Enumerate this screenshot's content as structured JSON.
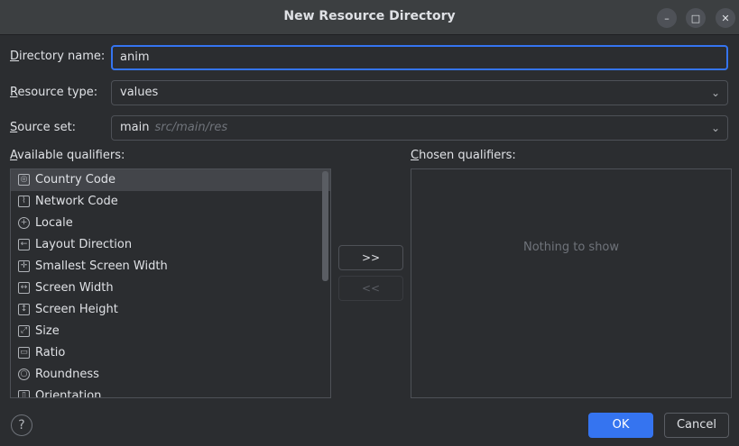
{
  "window": {
    "title": "New Resource Directory",
    "minimize": "–",
    "maximize": "□",
    "close": "✕"
  },
  "form": {
    "directory_name_label_first": "D",
    "directory_name_label_rest": "irectory name:",
    "directory_name_value": "anim",
    "resource_type_label_first": "R",
    "resource_type_label_rest": "esource type:",
    "resource_type_value": "values",
    "source_set_label_first": "S",
    "source_set_label_rest": "ource set:",
    "source_set_value": "main",
    "source_set_hint": "src/main/res"
  },
  "qualifiers": {
    "available_label_first": "A",
    "available_label_rest": "vailable qualifiers:",
    "chosen_label_first": "C",
    "chosen_label_rest": "hosen qualifiers:",
    "items": [
      {
        "label": "Country Code",
        "icon": "country-code-icon"
      },
      {
        "label": "Network Code",
        "icon": "network-code-icon"
      },
      {
        "label": "Locale",
        "icon": "globe-icon"
      },
      {
        "label": "Layout Direction",
        "icon": "layout-direction-icon"
      },
      {
        "label": "Smallest Screen Width",
        "icon": "smallest-width-icon"
      },
      {
        "label": "Screen Width",
        "icon": "screen-width-icon"
      },
      {
        "label": "Screen Height",
        "icon": "screen-height-icon"
      },
      {
        "label": "Size",
        "icon": "size-icon"
      },
      {
        "label": "Ratio",
        "icon": "ratio-icon"
      },
      {
        "label": "Roundness",
        "icon": "roundness-icon"
      },
      {
        "label": "Orientation",
        "icon": "orientation-icon"
      }
    ],
    "chosen_empty": "Nothing to show",
    "add_button": ">>",
    "remove_button": "<<"
  },
  "footer": {
    "help": "?",
    "ok": "OK",
    "cancel": "Cancel"
  },
  "colors": {
    "accent": "#3574f0",
    "background": "#2b2d30"
  }
}
